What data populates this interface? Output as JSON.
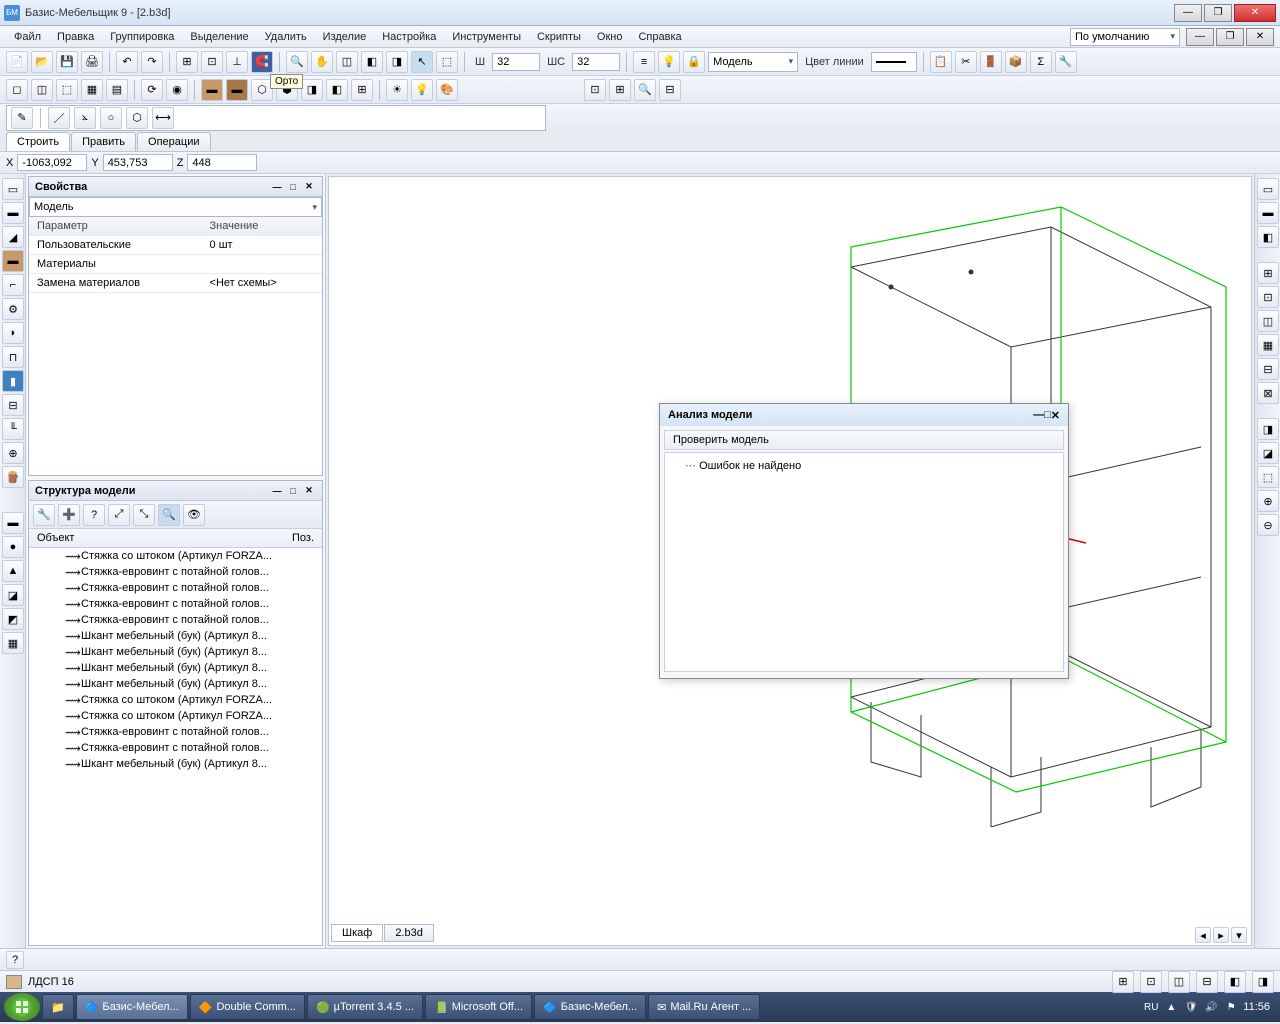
{
  "titlebar": {
    "title": "Базис-Мебельщик 9 - [2.b3d]"
  },
  "menu": {
    "items": [
      "Файл",
      "Правка",
      "Группировка",
      "Выделение",
      "Удалить",
      "Изделие",
      "Настройка",
      "Инструменты",
      "Скрипты",
      "Окно",
      "Справка"
    ],
    "right_combo": "По умолчанию"
  },
  "toolbar1": {
    "w_label": "Ш",
    "w_value": "32",
    "wc_label": "ШС",
    "wc_value": "32",
    "model_label": "Модель",
    "linecolor_label": "Цвет линии",
    "tooltip": "Орто"
  },
  "tabs": {
    "build": "Строить",
    "edit": "Править",
    "ops": "Операции"
  },
  "coords": {
    "x_label": "X",
    "x": "-1063,092",
    "y_label": "Y",
    "y": "453,753",
    "z_label": "Z",
    "z": "448"
  },
  "properties": {
    "title": "Свойства",
    "combo": "Модель",
    "header_param": "Параметр",
    "header_value": "Значение",
    "rows": [
      {
        "p": "Пользовательские",
        "v": "0 шт"
      },
      {
        "p": "Материалы",
        "v": ""
      },
      {
        "p": "Замена материалов",
        "v": "<Нет схемы>"
      }
    ]
  },
  "structure": {
    "title": "Структура модели",
    "header_obj": "Объект",
    "header_pos": "Поз.",
    "items": [
      "Стяжка со штоком (Артикул FORZA...",
      "Стяжка-евровинт с потайной голов...",
      "Стяжка-евровинт с потайной голов...",
      "Стяжка-евровинт с потайной голов...",
      "Стяжка-евровинт с потайной голов...",
      "Шкант мебельный (бук) (Артикул 8...",
      "Шкант мебельный (бук) (Артикул 8...",
      "Шкант мебельный (бук) (Артикул 8...",
      "Шкант мебельный (бук) (Артикул 8...",
      "Стяжка со штоком (Артикул FORZA...",
      "Стяжка со штоком (Артикул FORZA...",
      "Стяжка-евровинт с потайной голов...",
      "Стяжка-евровинт с потайной голов...",
      "Шкант мебельный (бук) (Артикул 8..."
    ]
  },
  "dialog": {
    "title": "Анализ модели",
    "check": "Проверить модель",
    "result": "Ошибок не найдено"
  },
  "viewport_tabs": {
    "t1": "Шкаф",
    "t2": "2.b3d"
  },
  "material": {
    "label": "ЛДСП 16"
  },
  "status": {
    "help": "?"
  },
  "taskbar": {
    "items": [
      "Базис-Мебел...",
      "Double Comm...",
      "µTorrent 3.4.5 ...",
      "Microsoft Off...",
      "Базис-Мебел...",
      "Mail.Ru Агент ..."
    ],
    "lang": "RU",
    "time": "11:56"
  }
}
